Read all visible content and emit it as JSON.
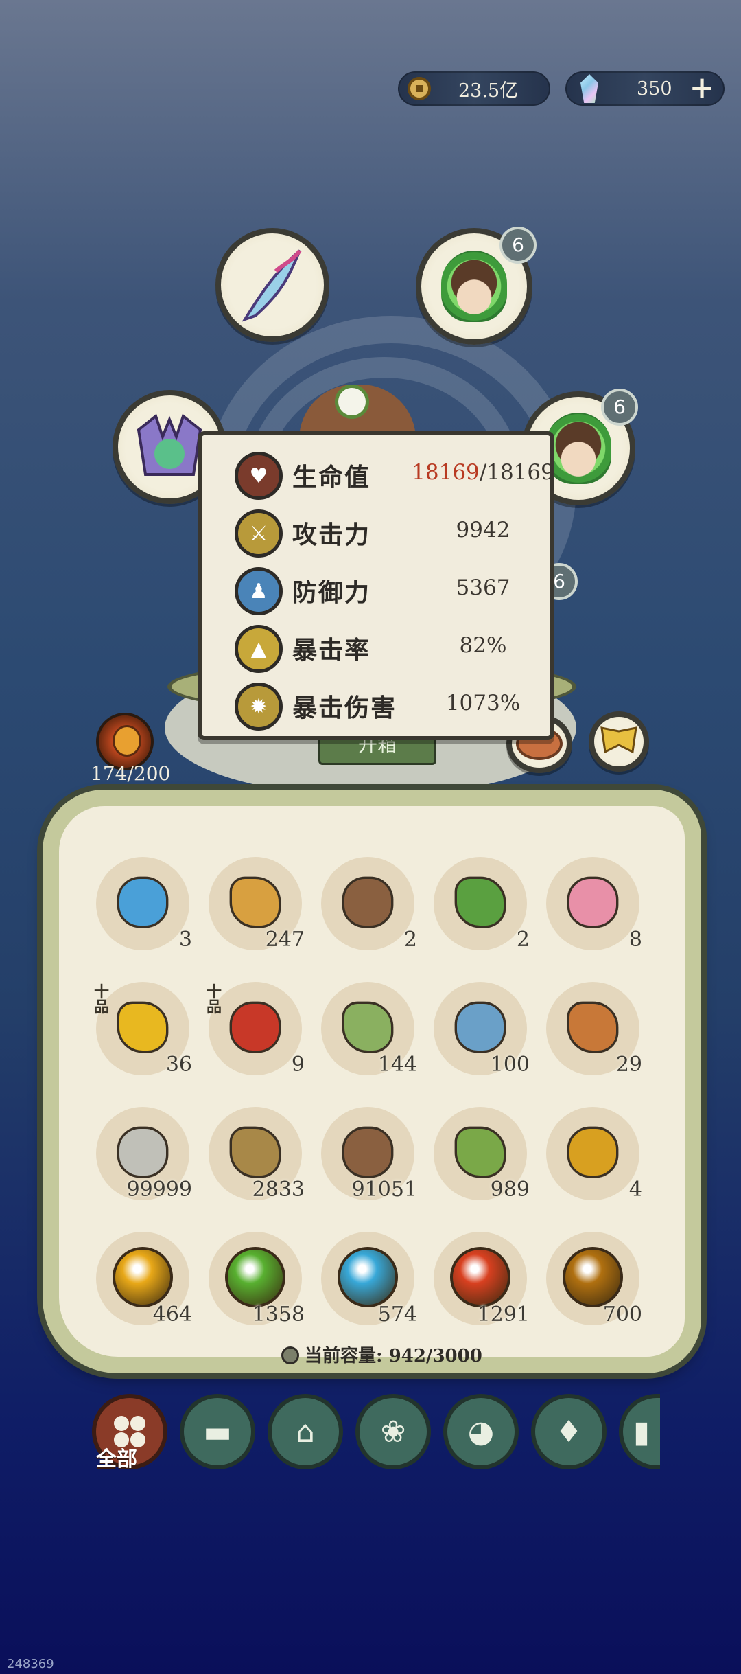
{
  "currency": {
    "coins": "23.5亿",
    "gems": "350",
    "coin_icon": "copper-coin-icon",
    "gem_icon": "crystal-icon"
  },
  "team": {
    "slots": [
      {
        "icon": "feather-blade-icon",
        "badge": ""
      },
      {
        "icon": "hero-portrait-icon",
        "badge": "6"
      },
      {
        "icon": "beast-icon",
        "badge": ""
      },
      {
        "icon": "hero-portrait-icon",
        "badge": "6"
      },
      {
        "icon": "hero-portrait-icon",
        "badge": "6"
      }
    ],
    "open_label": "开箱"
  },
  "stats": [
    {
      "label": "生命值",
      "current": "18169",
      "max": "/18169",
      "icon": "heart-icon",
      "color": "#7a3b2c"
    },
    {
      "label": "攻击力",
      "value": "9942",
      "icon": "sword-icon",
      "color": "#b89a3a"
    },
    {
      "label": "防御力",
      "value": "5367",
      "icon": "person-icon",
      "color": "#4a84b8"
    },
    {
      "label": "暴击率",
      "value": "82%",
      "icon": "flame-icon",
      "color": "#c8a83a"
    },
    {
      "label": "暴击伤害",
      "value": "1073%",
      "icon": "burst-icon",
      "color": "#b89a3a"
    }
  ],
  "energy": {
    "value": "174/200"
  },
  "inventory": {
    "items": [
      {
        "name": "treasure-chest-icon",
        "count": "3",
        "color": "#4aa0d8"
      },
      {
        "name": "scroll-icon",
        "count": "247",
        "color": "#d8a040"
      },
      {
        "name": "tray-icon",
        "count": "2",
        "color": "#8a6040"
      },
      {
        "name": "gourd-icon",
        "count": "2",
        "color": "#5aa040"
      },
      {
        "name": "lotus-icon",
        "count": "8",
        "color": "#e890a8"
      },
      {
        "name": "yellow-berries-icon",
        "count": "36",
        "color": "#e8b820",
        "tag": "十品"
      },
      {
        "name": "red-berries-icon",
        "count": "9",
        "color": "#c83828",
        "tag": "十品"
      },
      {
        "name": "green-pouch-icon",
        "count": "144",
        "color": "#8ab060"
      },
      {
        "name": "blue-pouch-icon",
        "count": "100",
        "color": "#6aa0c8"
      },
      {
        "name": "token-icon",
        "count": "29",
        "color": "#c87838"
      },
      {
        "name": "stone-icon",
        "count": "99999",
        "color": "#c0c0b8"
      },
      {
        "name": "grass-icon",
        "count": "2833",
        "color": "#a88848"
      },
      {
        "name": "log-icon",
        "count": "91051",
        "color": "#8a6040"
      },
      {
        "name": "bamboo-icon",
        "count": "989",
        "color": "#7aa848"
      },
      {
        "name": "flower-branch-icon",
        "count": "4",
        "color": "#d8a020"
      },
      {
        "name": "gold-orb-icon",
        "count": "464",
        "color": "#e8a818"
      },
      {
        "name": "green-orb-icon",
        "count": "1358",
        "color": "#58b030"
      },
      {
        "name": "cyan-orb-icon",
        "count": "574",
        "color": "#38a8d8"
      },
      {
        "name": "fire-orb-icon",
        "count": "1291",
        "color": "#d84020"
      },
      {
        "name": "bronze-orb-icon",
        "count": "700",
        "color": "#b07010"
      }
    ],
    "capacity_label": "当前容量:",
    "capacity_value": "942/3000"
  },
  "tabs": [
    {
      "icon": "grid-icon",
      "label": "全部",
      "active": true
    },
    {
      "icon": "log-icon"
    },
    {
      "icon": "house-icon"
    },
    {
      "icon": "herb-icon"
    },
    {
      "icon": "bowl-icon"
    },
    {
      "icon": "map-icon"
    },
    {
      "icon": "scroll-icon"
    }
  ],
  "footer_id": "248369"
}
